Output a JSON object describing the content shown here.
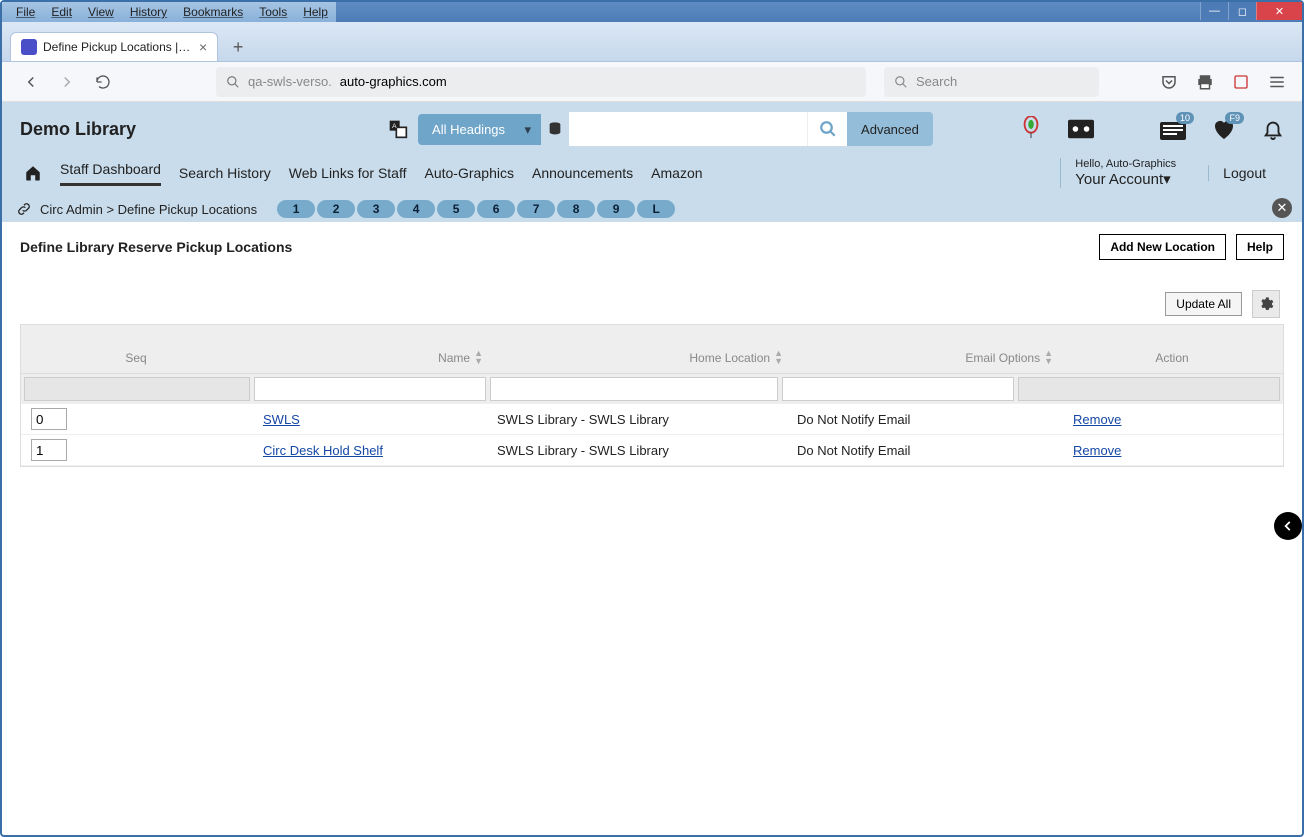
{
  "browser_menus": [
    "File",
    "Edit",
    "View",
    "History",
    "Bookmarks",
    "Tools",
    "Help"
  ],
  "tab": {
    "title": "Define Pickup Locations | SWLS"
  },
  "url": {
    "prefix": "qa-swls-verso.",
    "domain": "auto-graphics.com"
  },
  "searchbox_placeholder": "Search",
  "app": {
    "brand": "Demo Library",
    "dropdown": "All Headings",
    "advanced": "Advanced",
    "badges": {
      "card": "10",
      "heart": "F9"
    },
    "nav": [
      "Staff Dashboard",
      "Search History",
      "Web Links for Staff",
      "Auto-Graphics",
      "Announcements",
      "Amazon"
    ],
    "account_hello": "Hello, Auto-Graphics",
    "account_label": "Your Account",
    "logout": "Logout"
  },
  "breadcrumb": {
    "path": "Circ Admin  >  Define Pickup Locations",
    "sessions": [
      "1",
      "2",
      "3",
      "4",
      "5",
      "6",
      "7",
      "8",
      "9",
      "L"
    ]
  },
  "page": {
    "title": "Define Library Reserve Pickup Locations",
    "add_btn": "Add New Location",
    "help_btn": "Help",
    "update_btn": "Update All"
  },
  "columns": {
    "seq": "Seq",
    "name": "Name",
    "home": "Home Location",
    "email": "Email Options",
    "action": "Action"
  },
  "rows": [
    {
      "seq": "0",
      "name": "SWLS",
      "home": "SWLS Library - SWLS Library",
      "email": "Do Not Notify Email",
      "action": "Remove"
    },
    {
      "seq": "1",
      "name": "Circ Desk Hold Shelf",
      "home": "SWLS Library - SWLS Library",
      "email": "Do Not Notify Email",
      "action": "Remove"
    }
  ]
}
